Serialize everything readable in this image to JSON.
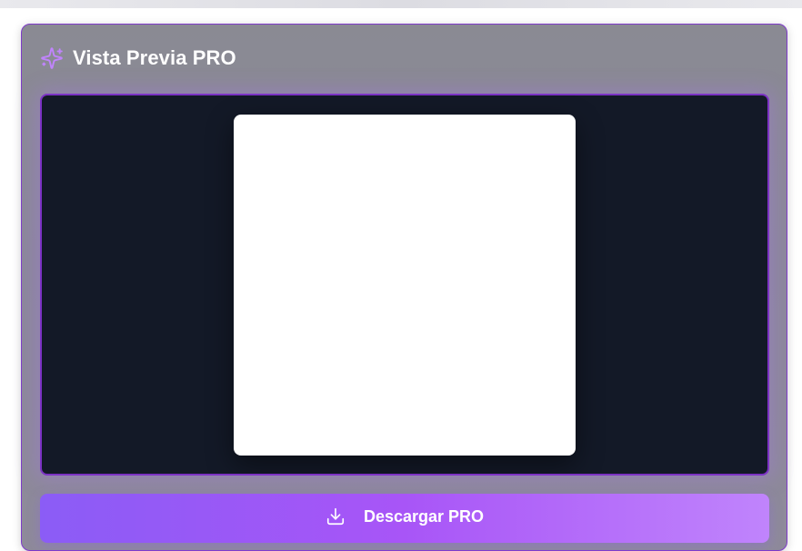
{
  "panel": {
    "title": "Vista Previa PRO",
    "title_icon": "sparkles-icon"
  },
  "preview": {
    "canvas_color": "#ffffff",
    "background_color": "#131927",
    "border_color": "#7c32c4"
  },
  "actions": {
    "download_label": "Descargar PRO",
    "download_icon": "download-icon",
    "button_gradient": [
      "#8b5cf6",
      "#a855f7",
      "#c084fc"
    ]
  }
}
